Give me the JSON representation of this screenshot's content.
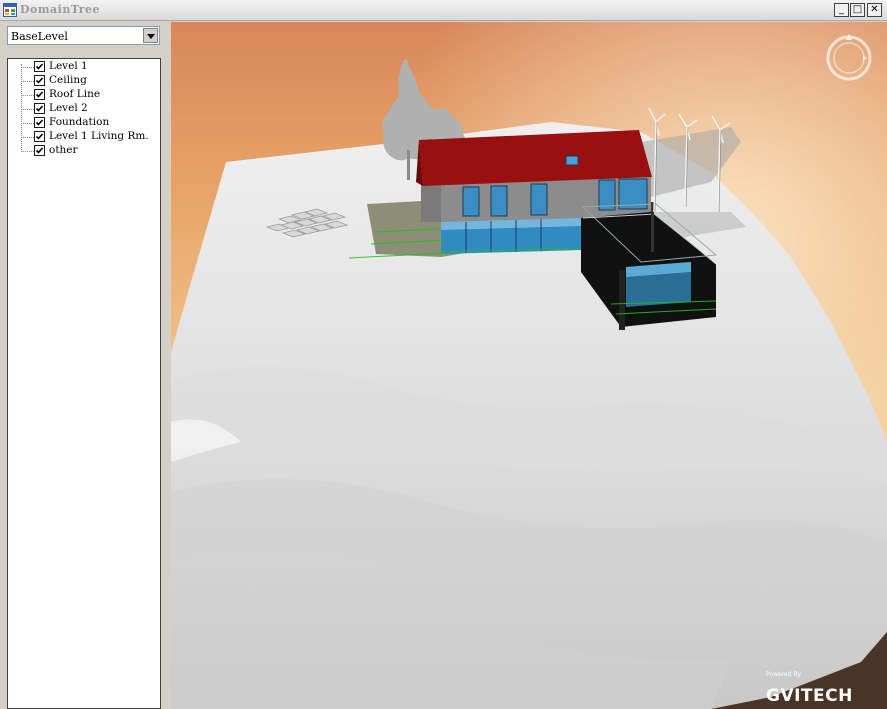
{
  "window": {
    "title": "DomainTree",
    "minimize_label": "_",
    "maximize_label": "□",
    "close_label": "✕"
  },
  "level_select": {
    "selected": "BaseLevel"
  },
  "tree": {
    "items": [
      {
        "label": "Level 1",
        "checked": true
      },
      {
        "label": "Ceiling",
        "checked": true
      },
      {
        "label": "Roof Line",
        "checked": true
      },
      {
        "label": "Level 2",
        "checked": true
      },
      {
        "label": "Foundation",
        "checked": true
      },
      {
        "label": "Level 1 Living Rm.",
        "checked": true
      },
      {
        "label": "other",
        "checked": true
      }
    ]
  },
  "viewport": {
    "logo_powered": "Powered By",
    "logo_text": "GVITECH"
  },
  "colors": {
    "roof": "#9a0f10",
    "glass": "#3a9fd0",
    "terrain": "#e8e8e8",
    "sky_top": "#e8a060",
    "accent_lines": "#20c020"
  },
  "icons": {
    "app": "app-window-icon",
    "compass": "navigation-compass-icon"
  }
}
